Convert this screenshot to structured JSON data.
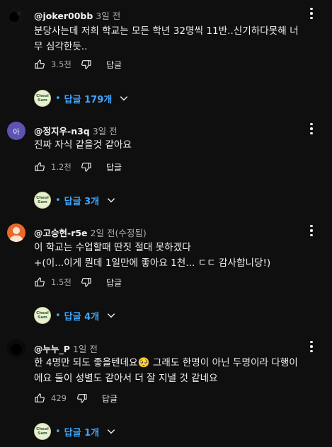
{
  "comments": [
    {
      "author": "@joker00bb",
      "time": "3일 전",
      "text_lines": [
        "분당사는데 저희 학교는 모든 학년 32명씩 11반..신기하다못해 너",
        "무 심각한듯.."
      ],
      "likes": "3.5천",
      "reply_label": "답글",
      "replies_prefix": "•",
      "replies_label": "답글 179개",
      "replier_avatar": [
        "Cheol",
        "Sam"
      ]
    },
    {
      "author": "@정지우-n3q",
      "time": "3일 전",
      "avatar_letter": "아",
      "text_lines": [
        "진짜 자식 같을것 같아요"
      ],
      "likes": "1.2천",
      "reply_label": "답글",
      "replies_prefix": "•",
      "replies_label": "답글 3개",
      "replier_avatar": [
        "Cheol",
        "Sam"
      ]
    },
    {
      "author": "@고승현-r5e",
      "time": "2일 전(수정됨)",
      "text_lines": [
        "이 학교는 수업할때 딴짓 절대 못하겠다",
        "+(이...이게 뭔데 1일만에 좋아요 1천...  ㄷㄷ 감사합니당!)"
      ],
      "likes": "1.5천",
      "reply_label": "답글",
      "replies_prefix": "•",
      "replies_label": "답글 4개",
      "replier_avatar": [
        "Cheol",
        "Sam"
      ]
    },
    {
      "author": "@누누_P",
      "time": "1일 전",
      "text_lines": [
        "한 4명만 되도 좋을텐데요🥺 그래도 한명이 아닌 두명이라 다행이",
        "에요 둘이 성별도 같아서 더 잘 지낼 것 같네요"
      ],
      "likes": "429",
      "reply_label": "답글",
      "replies_prefix": "•",
      "replies_label": "답글 1개",
      "replier_avatar": [
        "Cheol",
        "Sam"
      ]
    }
  ],
  "colors": {
    "background": "#0f0f0f",
    "text": "#f1f1f1",
    "secondary": "#aaaaaa",
    "link_blue": "#3ea6ff",
    "avatar2_bg": "#5c53b3",
    "avatar3_bg": "#e9692c"
  },
  "icons": {
    "like": "thumbs-up-icon",
    "dislike": "thumbs-down-icon",
    "more": "more-vert-icon",
    "expand": "chevron-down-icon"
  }
}
